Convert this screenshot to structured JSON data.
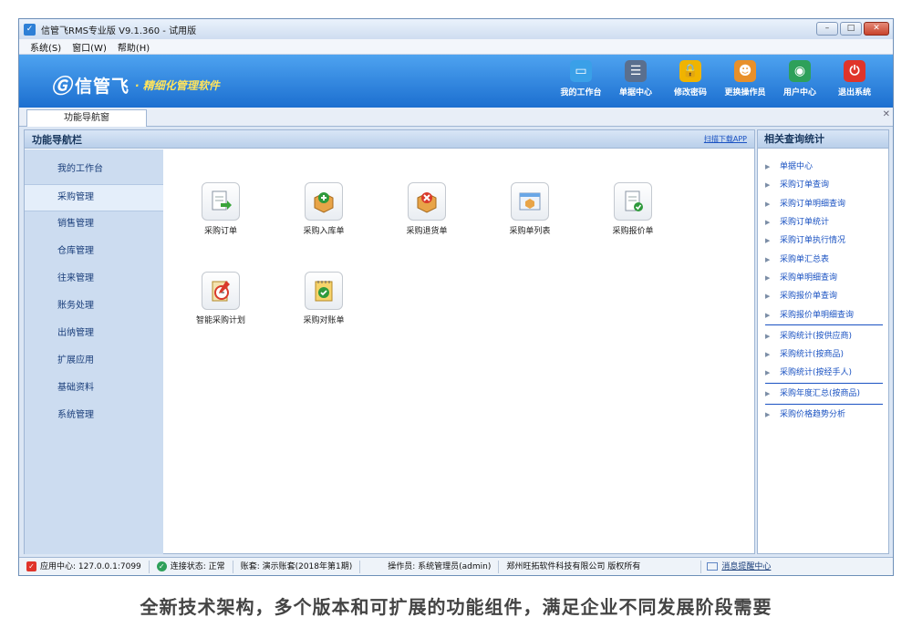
{
  "window": {
    "title": "信管飞RMS专业版 V9.1.360 - 试用版",
    "controls": [
      "–",
      "□",
      "✕"
    ]
  },
  "menubar": [
    "系统(S)",
    "窗口(W)",
    "帮助(H)"
  ],
  "banner": {
    "logo_mark": "Ⓖ",
    "logo_name": "信管飞",
    "slogan": "· 精细化管理软件",
    "toolbar": [
      {
        "label": "我的工作台",
        "icon": "monitor-icon",
        "glyph": "▭",
        "color": "#3aa0e8"
      },
      {
        "label": "单据中心",
        "icon": "list-icon",
        "glyph": "☰",
        "color": "#5a6f8e"
      },
      {
        "label": "修改密码",
        "icon": "lock-icon",
        "glyph": "🔒",
        "color": "#f0b400"
      },
      {
        "label": "更换操作员",
        "icon": "user-icon",
        "glyph": "☻",
        "color": "#e8902a"
      },
      {
        "label": "用户中心",
        "icon": "globe-icon",
        "glyph": "◉",
        "color": "#2ea05a"
      },
      {
        "label": "退出系统",
        "icon": "power-icon",
        "glyph": "⏻",
        "color": "#e0342a"
      }
    ]
  },
  "tabs": [
    {
      "label": "功能导航窗"
    }
  ],
  "nav": {
    "title": "功能导航栏",
    "download_link": "扫描下载APP",
    "sidebar": [
      {
        "label": "我的工作台",
        "active": false
      },
      {
        "label": "采购管理",
        "active": true
      },
      {
        "label": "销售管理",
        "active": false
      },
      {
        "label": "仓库管理",
        "active": false
      },
      {
        "label": "往来管理",
        "active": false
      },
      {
        "label": "账务处理",
        "active": false
      },
      {
        "label": "出纳管理",
        "active": false
      },
      {
        "label": "扩展应用",
        "active": false
      },
      {
        "label": "基础资料",
        "active": false
      },
      {
        "label": "系统管理",
        "active": false
      }
    ],
    "functions": [
      {
        "label": "采购订单",
        "icon": "document-arrow-icon"
      },
      {
        "label": "采购入库单",
        "icon": "box-plus-icon"
      },
      {
        "label": "采购退货单",
        "icon": "box-cross-icon"
      },
      {
        "label": "采购单列表",
        "icon": "window-list-icon"
      },
      {
        "label": "采购报价单",
        "icon": "document-check-icon"
      },
      {
        "label": "智能采购计划",
        "icon": "clipboard-clock-icon"
      },
      {
        "label": "采购对账单",
        "icon": "notepad-check-icon"
      }
    ]
  },
  "related": {
    "title": "相关查询统计",
    "items": [
      {
        "label": "单据中心",
        "sep": false
      },
      {
        "label": "采购订单查询",
        "sep": false
      },
      {
        "label": "采购订单明细查询",
        "sep": false
      },
      {
        "label": "采购订单统计",
        "sep": false
      },
      {
        "label": "采购订单执行情况",
        "sep": false
      },
      {
        "label": "采购单汇总表",
        "sep": false
      },
      {
        "label": "采购单明细查询",
        "sep": false
      },
      {
        "label": "采购报价单查询",
        "sep": false
      },
      {
        "label": "采购报价单明细查询",
        "sep": true
      },
      {
        "label": "采购统计(按供应商)",
        "sep": false
      },
      {
        "label": "采购统计(按商品)",
        "sep": false
      },
      {
        "label": "采购统计(按经手人)",
        "sep": true
      },
      {
        "label": "采购年度汇总(按商品)",
        "sep": true
      },
      {
        "label": "采购价格趋势分析",
        "sep": false
      }
    ]
  },
  "status": {
    "server": "应用中心: 127.0.0.1:7099",
    "connection": "连接状态: 正常",
    "account": "账套: 演示账套(2018年第1期)",
    "operator": "操作员: 系统管理员(admin)",
    "company": "郑州旺拓软件科技有限公司 版权所有",
    "message_center": "消息提醒中心"
  },
  "caption": "全新技术架构，多个版本和可扩展的功能组件，满足企业不同发展阶段需要"
}
